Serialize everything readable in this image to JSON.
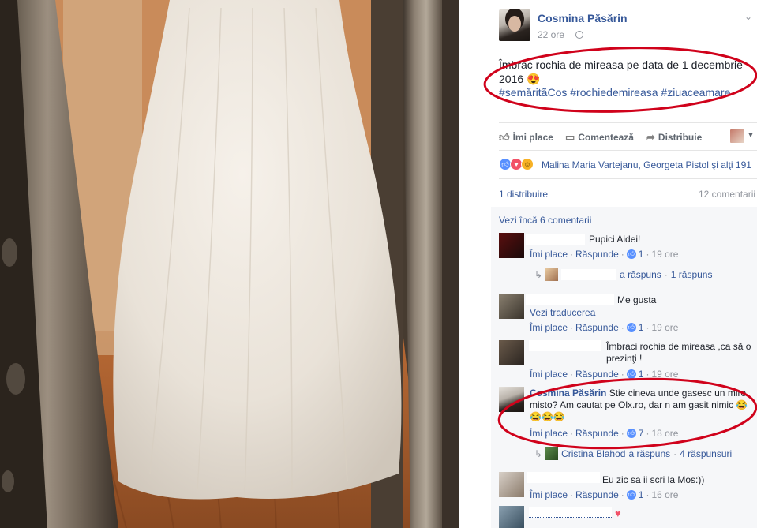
{
  "post": {
    "author": "Cosmina Păsărin",
    "time": "22 ore",
    "text": "Îmbrac rochia de mireasa pe data de 1 decembrie 2016 😍",
    "tags": "#semăritãCos #rochiedemireasa #ziuaceamare"
  },
  "actions": {
    "like": "Îmi place",
    "comment": "Comentează",
    "share": "Distribuie"
  },
  "reactions": {
    "names": "Malina Maria Vartejanu, Georgeta Pistol şi alţi 191",
    "shares": "1 distribuire",
    "comments": "12 comentarii",
    "more_comments": "Vezi încă 6 comentarii"
  },
  "icons": [
    "globe-icon",
    "chevron-down-icon",
    "like-icon",
    "comment-icon",
    "share-icon",
    "love-reaction-icon",
    "haha-reaction-icon",
    "reply-arrow-icon",
    "heart-icon"
  ],
  "comments": [
    {
      "text": "Pupici Aidei!",
      "like": "Îmi place",
      "reply": "Răspunde",
      "likes": "1",
      "time": "19 ore",
      "reply_summary_suffix": "a răspuns",
      "reply_count": "1 răspuns"
    },
    {
      "text": "Me gusta",
      "translate": "Vezi traducerea",
      "like": "Îmi place",
      "reply": "Răspunde",
      "likes": "1",
      "time": "19 ore"
    },
    {
      "text": "Îmbraci rochia de mireasa ,ca să o prezinţi !",
      "like": "Îmi place",
      "reply": "Răspunde",
      "likes": "1",
      "time": "19 ore"
    },
    {
      "author": "Cosmina Păsărin",
      "text": "Stie cineva unde gasesc un mire misto? Am cautat pe Olx.ro, dar n am gasit nimic 😂😂😂😂",
      "like": "Îmi place",
      "reply": "Răspunde",
      "likes": "7",
      "time": "18 ore",
      "reply_summary_name": "Cristina Blahod",
      "reply_summary_suffix": "a răspuns",
      "reply_count": "4 răspunsuri"
    },
    {
      "text": "Eu zic sa ii scri la Mos:))",
      "like": "Îmi place",
      "reply": "Răspunde",
      "likes": "1",
      "time": "16 ore"
    }
  ],
  "colors": {
    "link": "#365899",
    "muted": "#90949c",
    "annotation": "#d0021b",
    "like_blue": "#5890ff",
    "love_red": "#f25268"
  }
}
